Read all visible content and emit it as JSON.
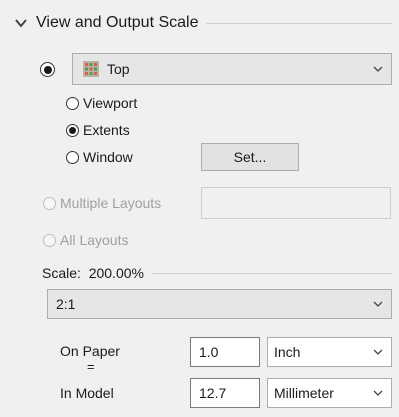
{
  "section": {
    "title": "View and Output Scale"
  },
  "view": {
    "selected_label": "Top",
    "icon": "grid-view-icon"
  },
  "area_options": [
    {
      "label": "Viewport",
      "selected": false
    },
    {
      "label": "Extents",
      "selected": true
    },
    {
      "label": "Window",
      "selected": false
    }
  ],
  "set_button": {
    "label": "Set..."
  },
  "layouts": {
    "multiple_label": "Multiple Layouts",
    "all_label": "All Layouts"
  },
  "scale": {
    "header": "Scale:  200.00%",
    "selected": "2:1"
  },
  "units": {
    "on_paper_label": "On Paper",
    "equals": "=",
    "in_model_label": "In Model",
    "paper_value": "1.0",
    "paper_unit": "Inch",
    "model_value": "12.7",
    "model_unit": "Millimeter"
  }
}
